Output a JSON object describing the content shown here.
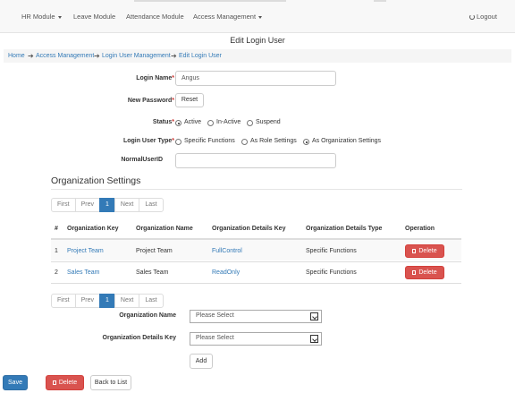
{
  "nav": {
    "items": [
      {
        "label": "HR Module",
        "dropdown": true
      },
      {
        "label": "Leave Module",
        "dropdown": false
      },
      {
        "label": "Attendance Module",
        "dropdown": false
      },
      {
        "label": "Access Management",
        "dropdown": true
      }
    ],
    "logout_label": "Logout"
  },
  "page": {
    "title": "Edit Login User"
  },
  "breadcrumb": [
    "Home",
    "Access Management",
    "Login User Management",
    "Edit Login User"
  ],
  "form": {
    "login_name_label": "Login Name",
    "login_name_value": "Angus",
    "new_password_label": "New Password",
    "reset_label": "Reset",
    "status_label": "Status",
    "status_options": [
      "Active",
      "In-Active",
      "Suspend"
    ],
    "status_selected": "Active",
    "user_type_label": "Login User Type",
    "user_type_options": [
      "Specific Functions",
      "As Role Settings",
      "As Organization Settings"
    ],
    "user_type_selected": "As Organization Settings",
    "normal_userid_label": "NormalUserID",
    "normal_userid_value": ""
  },
  "org": {
    "section_title": "Organization Settings",
    "pager": [
      "First",
      "Prev",
      "1",
      "Next",
      "Last"
    ],
    "pager_active": "1",
    "columns": [
      "#",
      "Organization Key",
      "Organization Name",
      "Organization Details Key",
      "Organization Details Type",
      "Operation"
    ],
    "rows": [
      {
        "num": "1",
        "key": "Project Team",
        "name": "Project Team",
        "details_key": "FullControl",
        "details_type": "Specific Functions",
        "op": "Delete"
      },
      {
        "num": "2",
        "key": "Sales Team",
        "name": "Sales Team",
        "details_key": "ReadOnly",
        "details_type": "Specific Functions",
        "op": "Delete"
      }
    ],
    "org_name_label": "Organization Name",
    "org_name_select": "Please Select",
    "org_details_label": "Organization Details Key",
    "org_details_select": "Please Select",
    "add_label": "Add"
  },
  "footer": {
    "save_label": "Save",
    "delete_label": "Delete",
    "back_label": "Back to List"
  },
  "colors": {
    "link": "#337ab7",
    "primary": "#337ab7",
    "danger": "#d9534f",
    "required": "#c9302c"
  }
}
